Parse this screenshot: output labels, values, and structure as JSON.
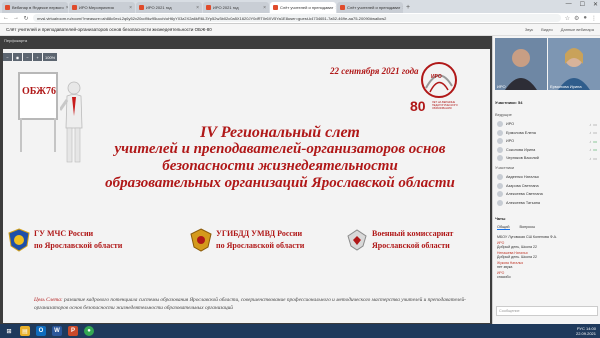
{
  "tabs": [
    {
      "label": "Вебинар в Яндексе первого"
    },
    {
      "label": "ИРО Мероприятия"
    },
    {
      "label": "ИРО 2021 год"
    },
    {
      "label": "ИРО 2021 год"
    },
    {
      "label": "Слёт учителей и преподават"
    },
    {
      "label": "Слёт учителей и преподават"
    }
  ],
  "address": {
    "url": "mvsl.virtualroom.ru/room/?measure=ah88c0ecL2q6y52v20cd9kz95ucch/oH6yY03z2X2a6kR6L3Yp52w3b02c0a5X1620JY0dRT0r6XV5Ya1E8user=guest-k4734651-7a52-469e-aa75-20090#wallow2"
  },
  "conference": {
    "title": "Слёт учителей и преподавателей-организаторов основ безопасности жизнедеятельности ОБЖ-80",
    "right_items": [
      "Звук",
      "Видео",
      "Данные вебинара"
    ]
  },
  "stage": {
    "label": "Перфокарта"
  },
  "controls": {
    "buttons": [
      "−",
      "◉",
      "−",
      "+",
      "100%"
    ]
  },
  "slide": {
    "board_label": "ОБЖ76",
    "date": "22 сентября 2021 года",
    "logo_number": "80",
    "logo_abbr": "ИРО",
    "logo_caption": "ЛЕТ НА ВЕРШИНЕ ПЕДАГОГИЧЕСКОГО ОБРАЗОВАНИЯ",
    "title_line1": "IV Региональный слет",
    "title_lines": [
      "учителей и преподавателей-организаторов основ",
      "безопасности жизнедеятельности",
      "образовательных организаций Ярославской области"
    ],
    "orgs": [
      {
        "line1": "ГУ МЧС России",
        "line2": "по Ярославской области",
        "emblem": "mchs-emblem"
      },
      {
        "line1": "УГИБДД УМВД России",
        "line2": "по Ярославской области",
        "emblem": "gibdd-emblem"
      },
      {
        "line1": "Военный комиссариат",
        "line2": "Ярославской области",
        "emblem": "military-emblem"
      }
    ],
    "goal_label": "Цель Слета:",
    "goal_text": " развитие кадрового потенциала системы образования Ярославской области, совершенствование профессионального и методического мастерства учителей и преподавателей-организаторов основ безопасности жизнедеятельности образовательных организаций"
  },
  "side": {
    "cams": [
      {
        "label": "ИРО"
      },
      {
        "label": "Ермолова Ирина"
      }
    ],
    "participants_header": "Участники: 54",
    "leaders_header": "Ведущие",
    "leaders": [
      "ИРО",
      "Ермолова Елена",
      "ИРО",
      "Соколова Ирина",
      "Черняков Василий"
    ],
    "members_header": "Участники",
    "members": [
      "Авдеенко Наталья",
      "Азарова Светлана",
      "Алексеева Светлана",
      "Алексеева Татьяна"
    ],
    "chat_tabs": [
      "Общий",
      "Вопросы"
    ],
    "chat_header": "Чаты",
    "messages": [
      {
        "who": "",
        "text": "МБОУ Луговская СШ Коленова Ф.А."
      },
      {
        "who": "ИРО",
        "text": "Добрый день, Школа 22"
      },
      {
        "who": "Ненашева Наталья",
        "text": "Добрый день. Школа 22"
      },
      {
        "who": "Жукова Наталья",
        "text": "нет звука"
      },
      {
        "who": "ИРО",
        "text": "спасибо"
      }
    ],
    "chat_placeholder": "Сообщение"
  },
  "taskbar": {
    "time": "14:00",
    "date": "22.09.2021",
    "lang": "РУС"
  }
}
